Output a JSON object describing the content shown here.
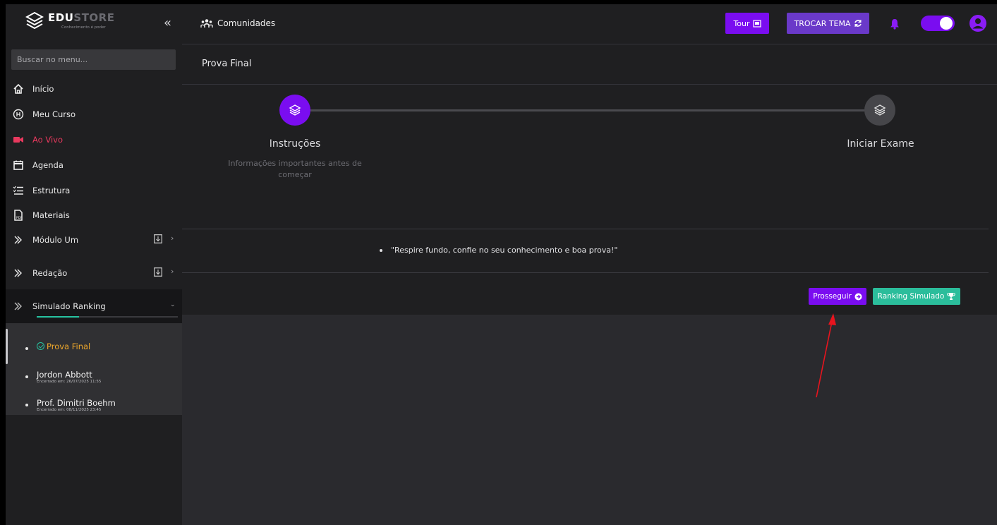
{
  "brand": {
    "name_bold": "EDU",
    "name_dim": "STORE",
    "tagline": "Conhecimento é poder"
  },
  "sidebar": {
    "collapse_icon": "«",
    "search_placeholder": "Buscar no menu...",
    "items": [
      {
        "label": "Início",
        "icon": "home-icon"
      },
      {
        "label": "Meu Curso",
        "icon": "course-icon"
      },
      {
        "label": "Ao Vivo",
        "icon": "video-camera-icon"
      },
      {
        "label": "Agenda",
        "icon": "calendar-icon"
      },
      {
        "label": "Estrutura",
        "icon": "list-check-icon"
      },
      {
        "label": "Materiais",
        "icon": "pdf-file-icon"
      },
      {
        "label": "Módulo Um",
        "icon": "chevron-double-right-icon"
      },
      {
        "label": "Redação",
        "icon": "chevron-double-right-icon"
      },
      {
        "label": "Simulado Ranking",
        "icon": "chevron-double-right-icon"
      }
    ],
    "sub_items": [
      {
        "label": "Prova Final",
        "meta": ""
      },
      {
        "label": "Jordon Abbott",
        "meta": "Encerrado em: 26/07/2025 11:55"
      },
      {
        "label": "Prof. Dimitri Boehm",
        "meta": "Encerrado em: 08/11/2025 23:45"
      }
    ]
  },
  "topbar": {
    "communities_label": "Comunidades",
    "tour_label": "Tour",
    "theme_label": "TROCAR TEMA"
  },
  "page": {
    "title": "Prova Final",
    "steps": [
      {
        "title": "Instruções",
        "description": "Informações importantes antes de começar"
      },
      {
        "title": "Iniciar Exame",
        "description": ""
      }
    ],
    "quote": "\"Respire fundo, confie no seu conhecimento e boa prova!\"",
    "proceed_label": "Prosseguir",
    "ranking_label": "Ranking Simulado"
  },
  "colors": {
    "accent": "#7a0df0",
    "teal": "#2bbd9b",
    "live": "#e8395e",
    "active": "#f0a92c",
    "annotation": "#e8141e"
  }
}
